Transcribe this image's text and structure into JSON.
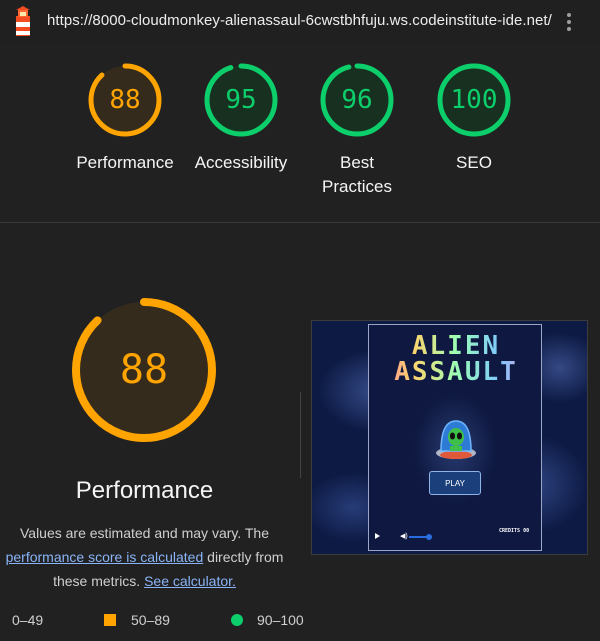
{
  "browser": {
    "url": "https://8000-cloudmonkey-alienassaul-6cwstbhfuju.ws.codeinstitute-ide.net/"
  },
  "colors": {
    "pass": "#0cce6b",
    "average": "#ffa400",
    "fail": "#ff4e42",
    "link": "#8ab4f8"
  },
  "summary": [
    {
      "score": "88",
      "label": "Performance",
      "value": 0.88,
      "rating": "average"
    },
    {
      "score": "95",
      "label": "Accessibility",
      "value": 0.95,
      "rating": "pass"
    },
    {
      "score": "96",
      "label": "Best\nPractices",
      "value": 0.96,
      "rating": "pass"
    },
    {
      "score": "100",
      "label": "SEO",
      "value": 1.0,
      "rating": "pass"
    }
  ],
  "detail": {
    "score": "88",
    "value": 0.88,
    "title": "Performance",
    "desc_before": "Values are estimated and may vary. The",
    "desc_link1": "performance score is calculated",
    "desc_middle": "directly from these metrics.",
    "desc_link2": "See calculator."
  },
  "screenshot": {
    "title_line1": "ALIEN",
    "title_line2": "ASSAULT",
    "play_label": "PLAY",
    "credits": "CREDITS 00"
  },
  "legend": {
    "fail_range": "0–49",
    "average_range": "50–89",
    "pass_range": "90–100"
  }
}
